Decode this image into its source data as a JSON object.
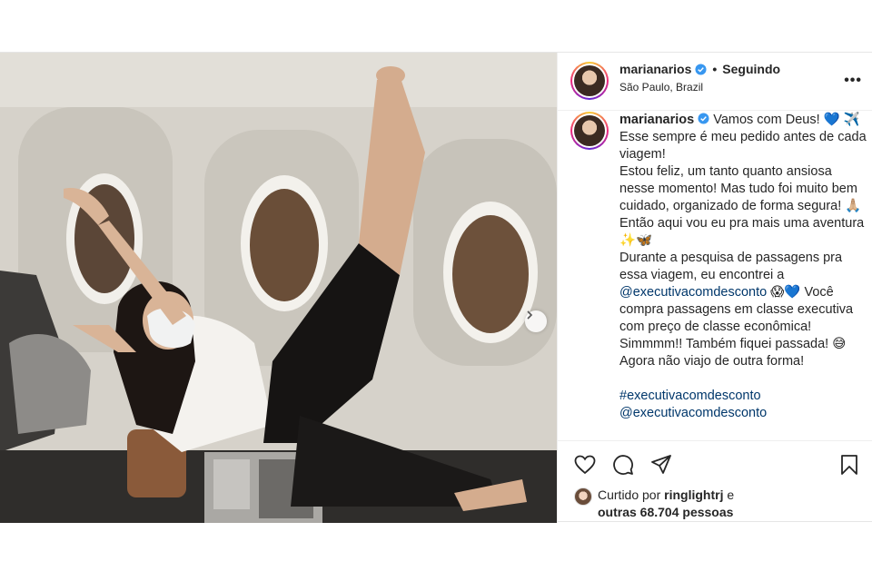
{
  "post": {
    "author": {
      "username": "marianarios",
      "verified": true,
      "follow_status": "Seguindo",
      "location": "São Paulo, Brazil"
    },
    "more_label": "•••",
    "caption": {
      "username": "marianarios",
      "line1": "Vamos com Deus! 💙 ✈️",
      "line2": "Esse sempre é meu pedido antes de cada viagem!",
      "line3": "Estou feliz, um tanto quanto ansiosa nesse momento! Mas tudo foi muito bem cuidado, organizado de forma segura! 🙏🏼 Então aqui vou eu pra mais uma aventura ✨🦋",
      "line4_pre": "Durante a pesquisa de passagens pra essa viagem, eu encontrei a",
      "mention1": "@executivacomdesconto",
      "line4_post": "😱💙 Você compra passagens em classe executiva com preço de classe econômica!",
      "line5": "Simmmm!! Também fiquei passada! 😅",
      "line6": "Agora não viajo de outra forma!",
      "hashtag": "#executivacomdesconto",
      "mention2": "@executivacomdesconto"
    },
    "likes": {
      "prefix": "Curtido por",
      "user": "ringlightrj",
      "connector": "e",
      "others": "outras 68.704 pessoas"
    }
  },
  "icons": {
    "like": "heart-icon",
    "comment": "comment-icon",
    "share": "paper-plane-icon",
    "save": "bookmark-icon",
    "next": "chevron-right-icon",
    "verified": "verified-badge-icon"
  },
  "colors": {
    "verified": "#3897f0",
    "link": "#00376b",
    "text": "#262626"
  }
}
